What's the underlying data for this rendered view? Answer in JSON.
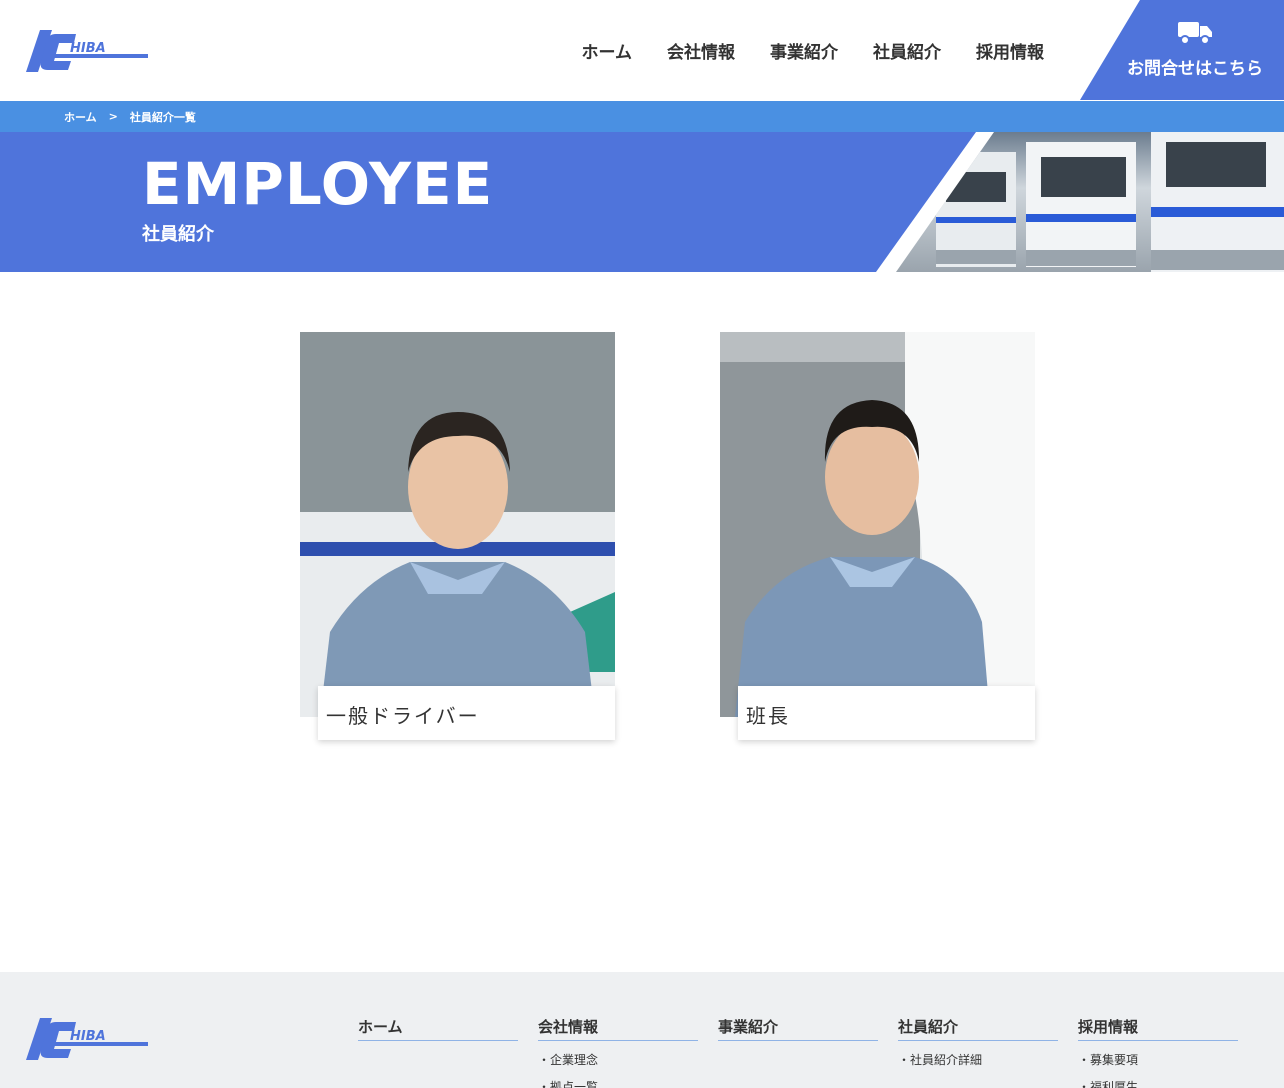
{
  "header": {
    "nav": [
      "ホーム",
      "会社情報",
      "事業紹介",
      "社員紹介",
      "採用情報"
    ],
    "contact_label": "お問合せはこちら",
    "contact_icon": "truck-icon"
  },
  "breadcrumb": {
    "home": "ホーム",
    "sep": ">",
    "current": "社員紹介一覧"
  },
  "hero": {
    "title": "EMPLOYEE",
    "subtitle": "社員紹介"
  },
  "employees": [
    {
      "title": "一般ドライバー"
    },
    {
      "title": "班長"
    }
  ],
  "footer": {
    "columns": [
      {
        "head": "ホーム",
        "links": []
      },
      {
        "head": "会社情報",
        "links": [
          "・企業理念",
          "・拠点一覧"
        ]
      },
      {
        "head": "事業紹介",
        "links": []
      },
      {
        "head": "社員紹介",
        "links": [
          "・社員紹介詳細"
        ]
      },
      {
        "head": "採用情報",
        "links": [
          "・募集要項",
          "・福利厚生"
        ]
      }
    ]
  },
  "colors": {
    "brand_blue": "#4f74db",
    "breadcrumb_blue": "#4a90e2",
    "footer_bg": "#eef0f2"
  }
}
